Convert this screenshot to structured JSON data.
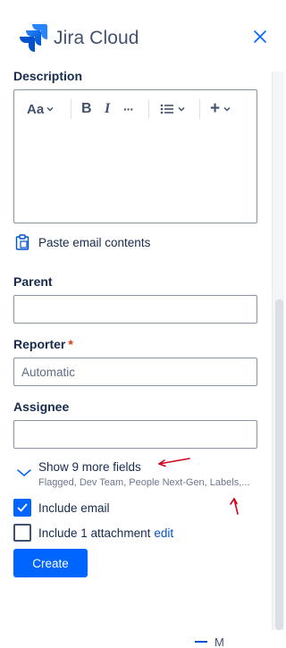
{
  "header": {
    "title": "Jira Cloud",
    "logo_icon": "jira-logo-icon",
    "close_icon": "close-icon"
  },
  "description": {
    "label": "Description",
    "toolbar": {
      "text_style": "Aa",
      "bold": "B",
      "italic": "I",
      "more": "···",
      "list_icon": "bullet-list-icon",
      "insert": "+"
    },
    "value": ""
  },
  "paste": {
    "label": "Paste email contents",
    "icon": "clipboard-icon"
  },
  "parent": {
    "label": "Parent",
    "value": ""
  },
  "reporter": {
    "label": "Reporter",
    "required_mark": "*",
    "value": "Automatic"
  },
  "assignee": {
    "label": "Assignee",
    "value": ""
  },
  "more_fields": {
    "title": "Show 9 more fields",
    "subtitle": "Flagged, Dev Team, People Next-Gen, Labels,..."
  },
  "include_email": {
    "label": "Include email",
    "checked": true
  },
  "include_attachment": {
    "label": "Include 1 attachment",
    "link": "edit",
    "checked": false
  },
  "create_button": {
    "label": "Create"
  },
  "footer": {
    "partial_text": "M"
  },
  "colors": {
    "accent": "#0065ff",
    "link": "#0052cc",
    "required": "#de350b",
    "annotation": "#d0021b"
  }
}
